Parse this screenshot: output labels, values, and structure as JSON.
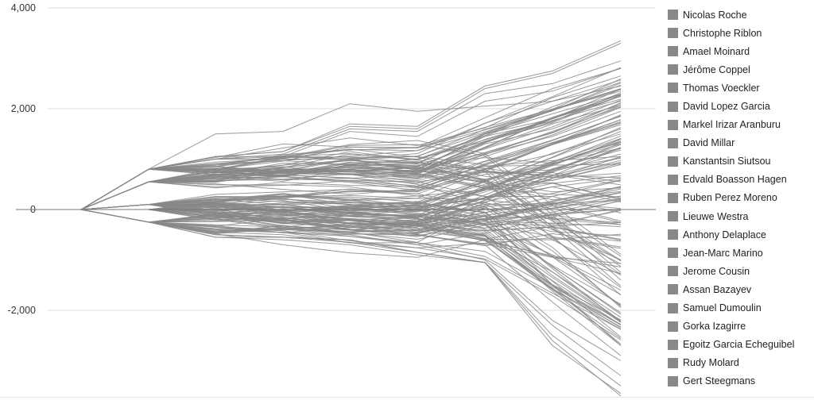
{
  "chart_data": {
    "type": "line",
    "title": "",
    "xlabel": "",
    "ylabel": "",
    "ylim": [
      -3800,
      4000
    ],
    "yticks": [
      4000,
      2000,
      0,
      -2000
    ],
    "ytick_labels": [
      "4,000",
      "2,000",
      "0",
      "-2,000"
    ],
    "x": [
      0,
      1,
      2,
      3,
      4,
      5,
      6,
      7,
      8
    ],
    "grid": true,
    "legend_position": "right",
    "line_color": "#888888",
    "zero_line_color": "#777777",
    "grid_color": "#dddddd",
    "series": [
      {
        "name": "Nicolas Roche",
        "values": [
          0,
          800,
          1050,
          1150,
          1700,
          1650,
          2450,
          2750,
          3350
        ]
      },
      {
        "name": "Christophe Riblon",
        "values": [
          0,
          800,
          1050,
          1150,
          1650,
          1600,
          2400,
          2700,
          3300
        ]
      },
      {
        "name": "Amael Moinard",
        "values": [
          0,
          800,
          1000,
          1100,
          1600,
          1550,
          2300,
          2500,
          2950
        ]
      },
      {
        "name": "Jérôme Coppel",
        "values": [
          0,
          800,
          1000,
          1050,
          1550,
          1450,
          2150,
          2350,
          2800
        ]
      },
      {
        "name": "Thomas Voeckler",
        "values": [
          0,
          800,
          1000,
          1000,
          1000,
          800,
          1450,
          1750,
          2250
        ]
      },
      {
        "name": "David Lopez Garcia",
        "values": [
          0,
          800,
          1050,
          1050,
          1000,
          780,
          1500,
          1800,
          2250
        ]
      },
      {
        "name": "Markel Irizar Aranburu",
        "values": [
          0,
          550,
          750,
          800,
          800,
          700,
          1300,
          1600,
          2100
        ]
      },
      {
        "name": "David Millar",
        "values": [
          0,
          550,
          700,
          750,
          750,
          650,
          1100,
          1450,
          1950
        ]
      },
      {
        "name": "Kanstantsin Siutsou",
        "values": [
          0,
          800,
          1500,
          1550,
          2100,
          1950,
          2050,
          2150,
          2450
        ]
      },
      {
        "name": "Edvald Boasson Hagen",
        "values": [
          0,
          100,
          300,
          350,
          400,
          350,
          800,
          1100,
          1600
        ]
      },
      {
        "name": "Ruben Perez Moreno",
        "values": [
          0,
          100,
          250,
          250,
          250,
          150,
          600,
          900,
          1350
        ]
      },
      {
        "name": "Lieuwe Westra",
        "values": [
          0,
          -250,
          -300,
          -350,
          -200,
          -300,
          450,
          750,
          1100
        ]
      },
      {
        "name": "Anthony Delaplace",
        "values": [
          0,
          -250,
          -500,
          -550,
          -600,
          -850,
          -1050,
          -2600,
          -3700
        ]
      },
      {
        "name": "Jean-Marc Marino",
        "values": [
          0,
          -250,
          -500,
          -550,
          -600,
          -850,
          -1050,
          -2500,
          -3500
        ]
      },
      {
        "name": "Jerome Cousin",
        "values": [
          0,
          -250,
          -550,
          -550,
          -650,
          -850,
          -1050,
          -2300,
          -3300
        ]
      },
      {
        "name": "Assan Bazayev",
        "values": [
          0,
          0,
          -50,
          -100,
          -200,
          -400,
          -100,
          -1500,
          -2700
        ]
      },
      {
        "name": "Samuel Dumoulin",
        "values": [
          0,
          -250,
          -400,
          -450,
          -500,
          -700,
          -1000,
          -2200,
          -3000
        ]
      },
      {
        "name": "Gorka Izagirre",
        "values": [
          0,
          100,
          200,
          200,
          150,
          0,
          -300,
          -900,
          -1600
        ]
      },
      {
        "name": "Egoitz Garcia Echeguibel",
        "values": [
          0,
          550,
          800,
          850,
          700,
          500,
          100,
          -400,
          -1000
        ]
      },
      {
        "name": "Rudy Molard",
        "values": [
          0,
          -250,
          -350,
          -400,
          -450,
          -650,
          50,
          -600,
          -1300
        ]
      },
      {
        "name": "Gert Steegmans",
        "values": [
          0,
          -250,
          -550,
          -600,
          -700,
          -900,
          -1050,
          -2700,
          -3650
        ]
      }
    ]
  },
  "legend": {
    "items": [
      "Nicolas Roche",
      "Christophe Riblon",
      "Amael Moinard",
      "Jérôme Coppel",
      "Thomas Voeckler",
      "David Lopez Garcia",
      "Markel Irizar Aranburu",
      "David Millar",
      "Kanstantsin Siutsou",
      "Edvald Boasson Hagen",
      "Ruben Perez Moreno",
      "Lieuwe Westra",
      "Anthony Delaplace",
      "Jean-Marc Marino",
      "Jerome Cousin",
      "Assan Bazayev",
      "Samuel Dumoulin",
      "Gorka Izagirre",
      "Egoitz Garcia Echeguibel",
      "Rudy Molard",
      "Gert Steegmans"
    ]
  }
}
